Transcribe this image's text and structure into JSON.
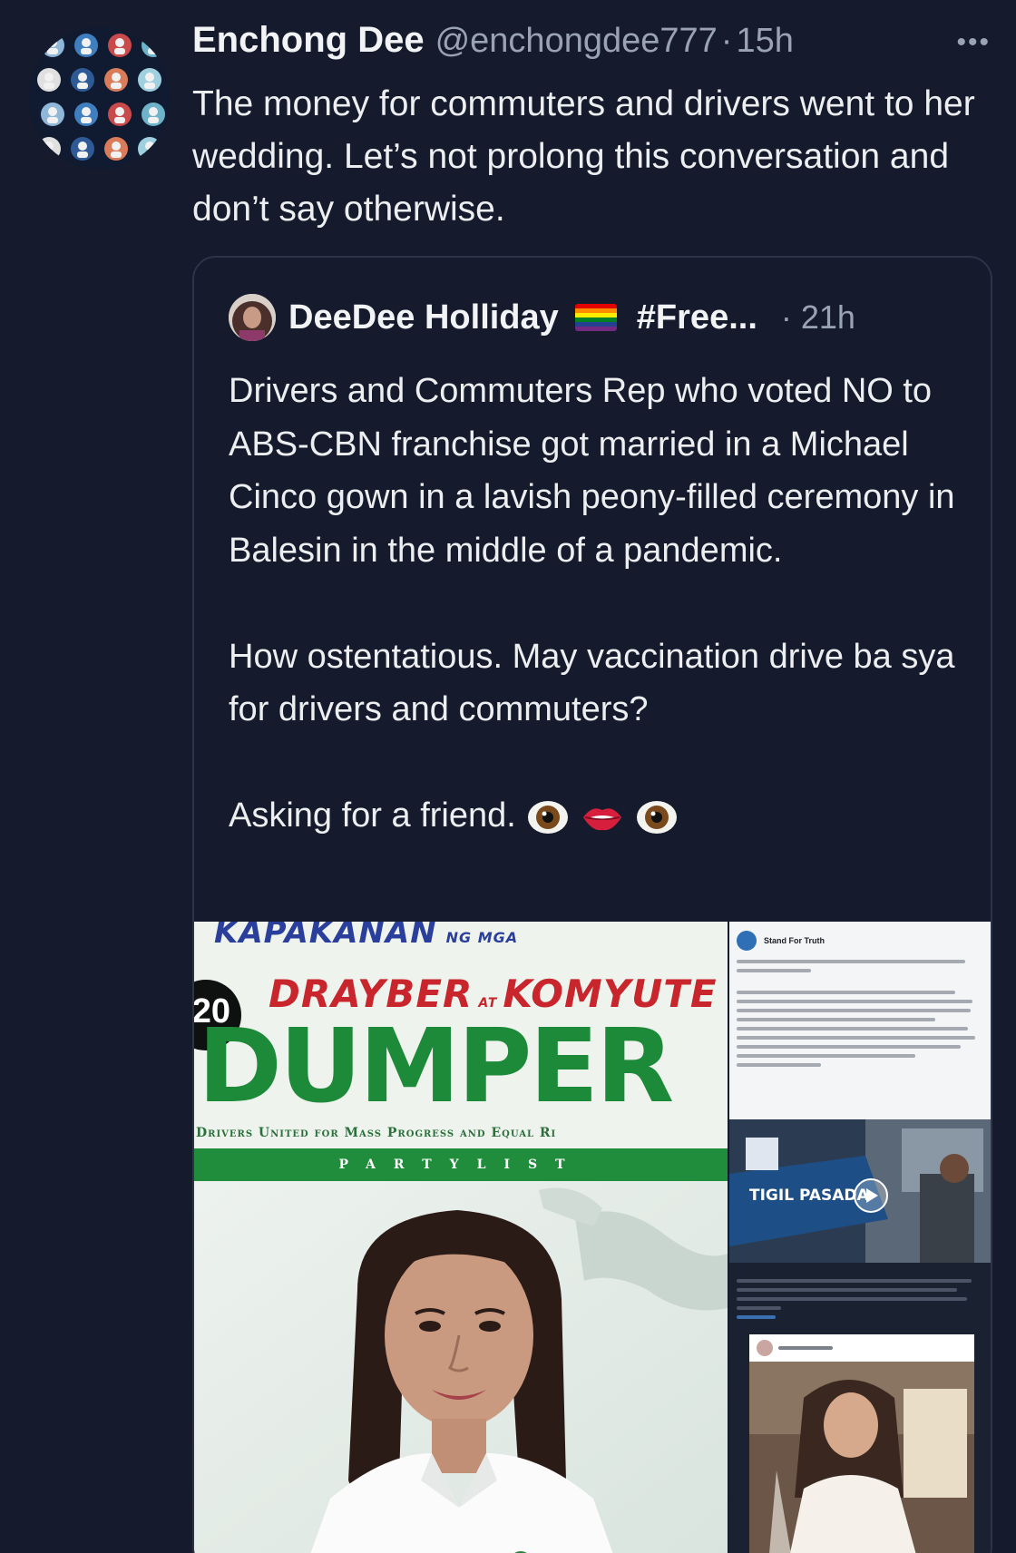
{
  "tweet": {
    "author_name": "Enchong Dee",
    "author_handle": "@enchongdee777",
    "separator": "·",
    "time": "15h",
    "more_icon": "more-horizontal-icon",
    "text": "The money for commuters and drivers went to her wedding. Let’s not prolong this conversation and don’t say otherwise."
  },
  "quote": {
    "author_name": "DeeDee Holliday",
    "flag_icon": "rainbow-flag-icon",
    "hashtag": "#Free...",
    "time": "· 21h",
    "paragraph_1": "Drivers and Commuters Rep who voted NO to ABS-CBN franchise got married in a Michael Cinco gown in a lavish peony-filled ceremony in Balesin in the middle of a pandemic.",
    "paragraph_2": "How ostentatious. May vaccination drive ba sya for drivers and commuters?",
    "paragraph_3": "Asking for a friend.",
    "emojis": [
      "eye-emoji-icon",
      "lips-emoji-icon",
      "eye-emoji-icon"
    ]
  },
  "media": {
    "poster": {
      "header": "KAPAKANAN",
      "header_small": "NG MGA",
      "number": "20",
      "line_1": "DRAYBER",
      "line_1_small": "AT",
      "line_2": "KOMYUTE",
      "brand": "DUMPER",
      "subtitle": "Drivers United for Mass Progress and Equal Ri",
      "band": "PARTYLIST"
    },
    "facebook_post": {
      "page_name": "Stand For Truth",
      "video_overlay": "TIGIL PASADA"
    }
  },
  "colors": {
    "background": "#151b2c",
    "card_border": "#2d3447",
    "secondary_text": "#9aa3b3",
    "poster_green": "#1d8a3a",
    "poster_red": "#c8252c",
    "poster_blue": "#2a3f9c"
  }
}
